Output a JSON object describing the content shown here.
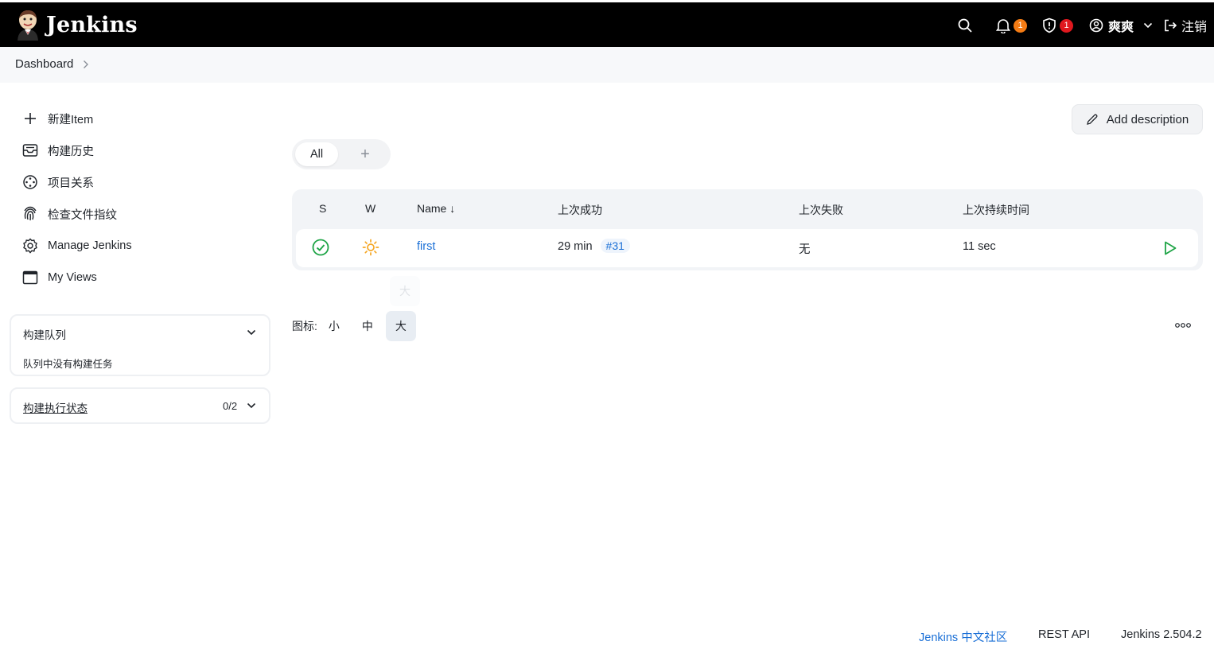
{
  "header": {
    "app_title": "Jenkins",
    "notifications_count": "1",
    "security_count": "1",
    "user_name": "爽爽",
    "logout_label": "注销",
    "badge_colors": {
      "notifications": "#f57c14",
      "security": "#e0181e"
    }
  },
  "breadcrumb": {
    "item": "Dashboard"
  },
  "sidebar": {
    "tasks": [
      {
        "label": "新建Item",
        "icon": "plus-icon"
      },
      {
        "label": "构建历史",
        "icon": "inbox-history-icon"
      },
      {
        "label": "项目关系",
        "icon": "relationship-icon"
      },
      {
        "label": "检查文件指纹",
        "icon": "fingerprint-icon"
      },
      {
        "label": "Manage Jenkins",
        "icon": "gear-icon"
      },
      {
        "label": "My Views",
        "icon": "window-icon"
      }
    ],
    "build_queue": {
      "title": "构建队列",
      "empty_text": "队列中没有构建任务"
    },
    "executor_status": {
      "title": "构建执行状态",
      "count": "0/2"
    }
  },
  "main": {
    "add_description": "Add description",
    "tabs": [
      {
        "label": "All",
        "active": true
      }
    ],
    "add_tab": "+",
    "table": {
      "headers": {
        "status": "S",
        "weather": "W",
        "name": "Name ↓",
        "last_success": "上次成功",
        "last_failure": "上次失败",
        "last_duration": "上次持续时间"
      },
      "rows": [
        {
          "status": "success",
          "weather": "sunny",
          "name": "first",
          "last_success_time": "29 min",
          "last_success_build": "#31",
          "last_failure": "无",
          "last_duration": "11 sec"
        }
      ]
    },
    "icon_size": {
      "label": "图标:",
      "options": [
        "小",
        "中",
        "大"
      ],
      "selected": "大"
    }
  },
  "footer": {
    "community": "Jenkins 中文社区",
    "rest_api": "REST API",
    "version": "Jenkins 2.504.2"
  },
  "colors": {
    "success": "#1ea446",
    "weather": "#f5a623",
    "link": "#1a6fd6"
  }
}
